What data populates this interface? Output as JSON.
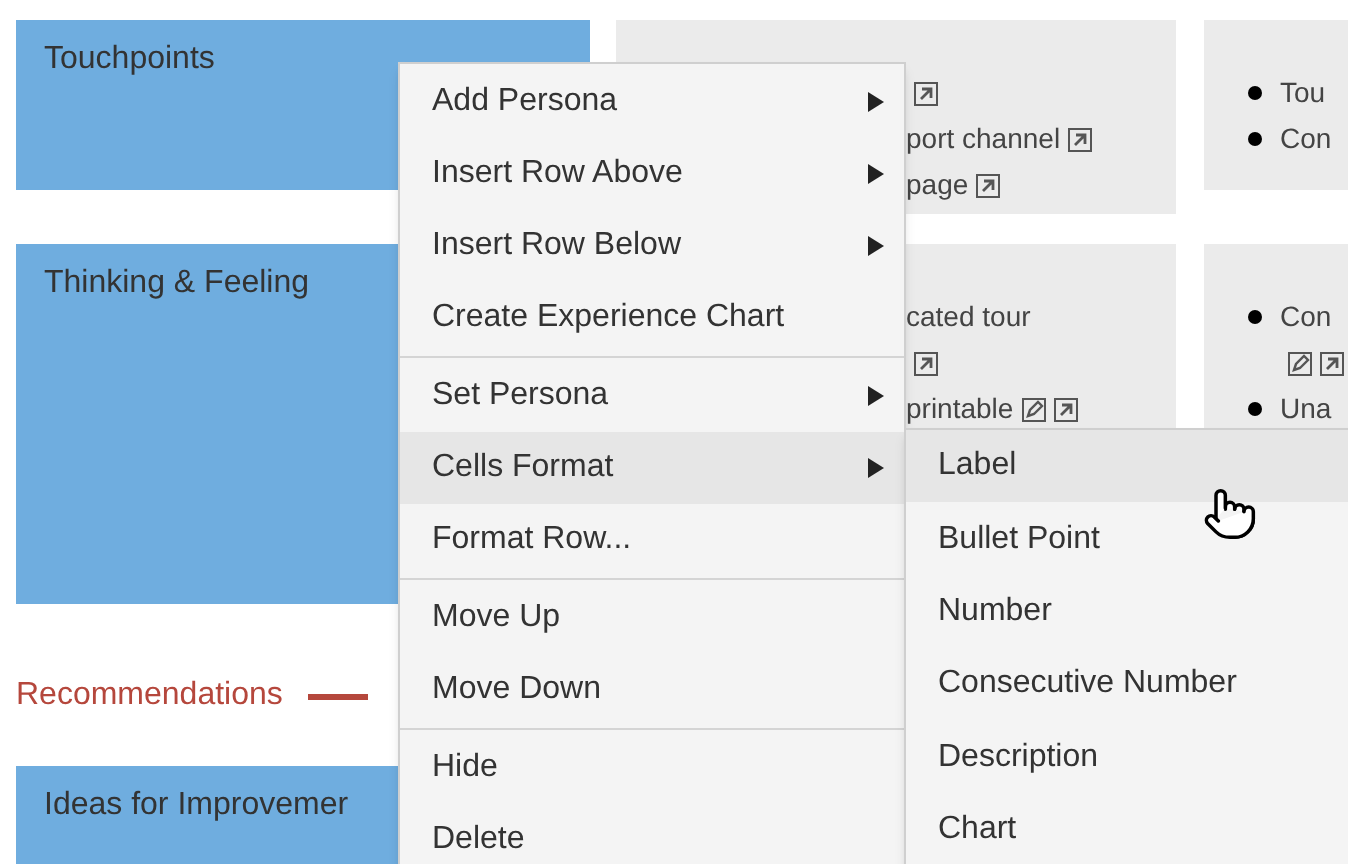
{
  "rows": [
    {
      "label": "Touchpoints",
      "cells": [
        {
          "lines": [
            {
              "icons": [
                {
                  "kind": "open"
                }
              ]
            },
            {
              "text": "port channel",
              "icons": [
                {
                  "kind": "open"
                }
              ]
            },
            {
              "text": "page",
              "icons": [
                {
                  "kind": "open"
                }
              ]
            }
          ]
        },
        {
          "lines": [
            {
              "bullet": true,
              "text": "Tou"
            },
            {
              "bullet": true,
              "text": "Con"
            }
          ]
        }
      ]
    },
    {
      "label": "Thinking & Feeling",
      "cells": [
        {
          "lines": [
            {
              "text": "cated tour"
            },
            {
              "icons": [
                {
                  "kind": "open"
                }
              ]
            },
            {
              "text": "printable",
              "icons": [
                {
                  "kind": "edit"
                },
                {
                  "kind": "open"
                }
              ]
            }
          ]
        },
        {
          "lines": [
            {
              "bullet": true,
              "text": "Con"
            },
            {
              "icons": [
                {
                  "kind": "edit"
                },
                {
                  "kind": "open"
                }
              ]
            },
            {
              "bullet": true,
              "text": "Una"
            }
          ]
        }
      ]
    }
  ],
  "section": {
    "title": "Recommendations"
  },
  "last_row": {
    "label": "Ideas for Improvemer"
  },
  "context_menu": {
    "items": [
      {
        "kind": "item",
        "label": "Add Persona",
        "submenu": true,
        "highlighted": false
      },
      {
        "kind": "item",
        "label": "Insert Row Above",
        "submenu": true,
        "highlighted": false
      },
      {
        "kind": "item",
        "label": "Insert Row Below",
        "submenu": true,
        "highlighted": false
      },
      {
        "kind": "item",
        "label": "Create Experience Chart",
        "submenu": false,
        "highlighted": false
      },
      {
        "kind": "separator"
      },
      {
        "kind": "item",
        "label": "Set Persona",
        "submenu": true,
        "highlighted": false
      },
      {
        "kind": "item",
        "label": "Cells Format",
        "submenu": true,
        "highlighted": true
      },
      {
        "kind": "item",
        "label": "Format Row...",
        "submenu": false,
        "highlighted": false
      },
      {
        "kind": "separator"
      },
      {
        "kind": "item",
        "label": "Move Up",
        "submenu": false,
        "highlighted": false
      },
      {
        "kind": "item",
        "label": "Move Down",
        "submenu": false,
        "highlighted": false
      },
      {
        "kind": "separator"
      },
      {
        "kind": "item",
        "label": "Hide",
        "submenu": false,
        "highlighted": false
      },
      {
        "kind": "item",
        "label": "Delete",
        "submenu": false,
        "highlighted": false
      }
    ]
  },
  "submenu": {
    "items": [
      {
        "label": "Label",
        "highlighted": true
      },
      {
        "label": "Bullet Point",
        "highlighted": false
      },
      {
        "label": "Number",
        "highlighted": false
      },
      {
        "label": "Consecutive Number",
        "highlighted": false
      },
      {
        "label": "Description",
        "highlighted": false
      },
      {
        "label": "Chart",
        "highlighted": false
      }
    ]
  }
}
